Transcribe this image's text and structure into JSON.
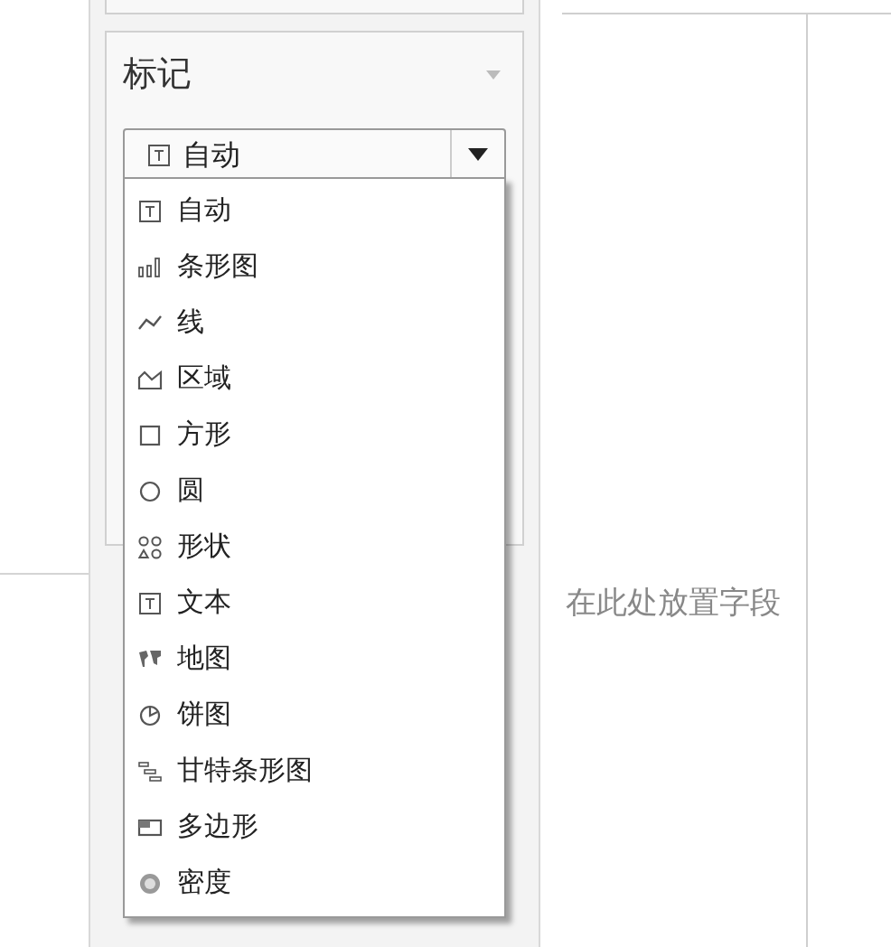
{
  "marks_card": {
    "title": "标记",
    "mark_type": {
      "value": "自动",
      "kind": "text"
    },
    "options": [
      {
        "label": "自动",
        "kind": "text"
      },
      {
        "label": "条形图",
        "kind": "bar"
      },
      {
        "label": "线",
        "kind": "line"
      },
      {
        "label": "区域",
        "kind": "area"
      },
      {
        "label": "方形",
        "kind": "square"
      },
      {
        "label": "圆",
        "kind": "circle"
      },
      {
        "label": "形状",
        "kind": "shapes"
      },
      {
        "label": "文本",
        "kind": "text"
      },
      {
        "label": "地图",
        "kind": "map"
      },
      {
        "label": "饼图",
        "kind": "pie"
      },
      {
        "label": "甘特条形图",
        "kind": "gantt"
      },
      {
        "label": "多边形",
        "kind": "polygon"
      },
      {
        "label": "密度",
        "kind": "density"
      }
    ]
  },
  "canvas": {
    "drop_hint": "在此处放置字段"
  }
}
